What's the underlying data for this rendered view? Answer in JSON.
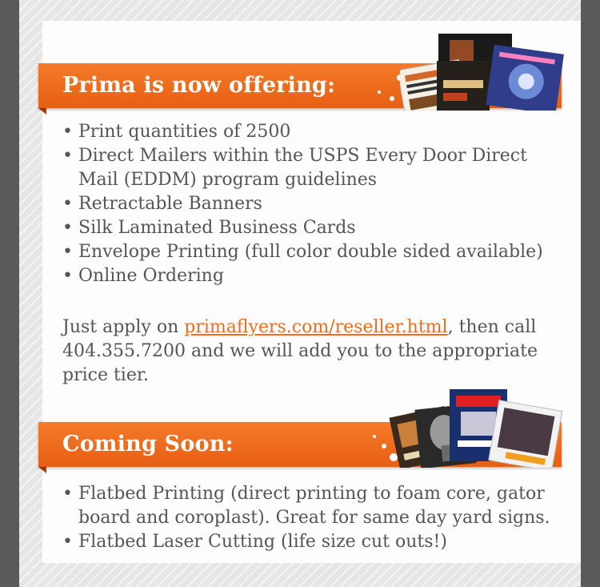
{
  "section1": {
    "title": "Prima is now offering:",
    "items": [
      "Print quantities of 2500",
      "Direct Mailers within the USPS Every Door Direct Mail (EDDM) program guidelines",
      "Retractable Banners",
      "Silk Laminated Business Cards",
      "Envelope Printing (full color double sided available)",
      "Online Ordering"
    ]
  },
  "note": {
    "prefix": "Just apply on ",
    "link_text": "primaflyers.com/reseller.html",
    "suffix": ", then call 404.355.7200 and we will add you to the appropriate price tier."
  },
  "section2": {
    "title": "Coming Soon:",
    "items": [
      "Flatbed Printing (direct printing to foam core, gator board and coroplast). Great for same day yard signs.",
      "Flatbed Laser Cutting (life size cut outs!)"
    ]
  },
  "colors": {
    "accent": "#f26d1a",
    "text": "#555555",
    "frame": "#5a5a5a"
  },
  "icons": {
    "bullet": "•"
  }
}
